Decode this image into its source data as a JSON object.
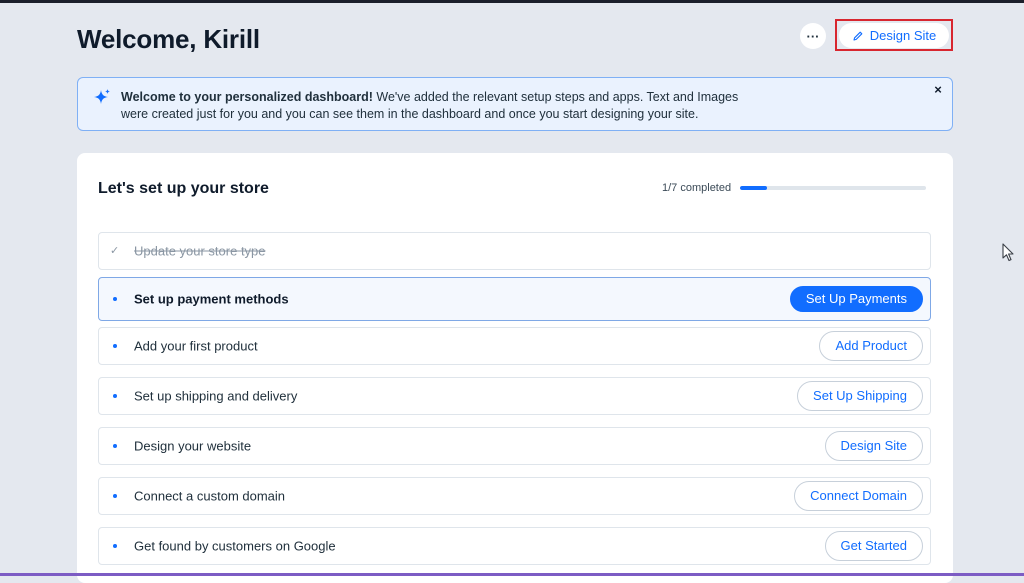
{
  "header": {
    "title": "Welcome, Kirill",
    "more_label": "···",
    "design_site_label": "Design Site"
  },
  "banner": {
    "bold_text": "Welcome to your personalized dashboard!",
    "text": " We've added the relevant setup steps and apps. Text and Images were created just for you and you can see them in the dashboard and once you start designing your site.",
    "close_label": "×"
  },
  "setup": {
    "title": "Let's set up your store",
    "progress_label": "1/7 completed",
    "progress_fraction": 0.143,
    "tasks": [
      {
        "label": "Update your store type",
        "status": "done",
        "check": "✓"
      },
      {
        "label": "Set up payment methods",
        "status": "active",
        "button": "Set Up Payments"
      },
      {
        "label": "Add your first product",
        "status": "todo",
        "button": "Add Product"
      },
      {
        "label": "Set up shipping and delivery",
        "status": "todo",
        "button": "Set Up Shipping"
      },
      {
        "label": "Design your website",
        "status": "todo",
        "button": "Design Site"
      },
      {
        "label": "Connect a custom domain",
        "status": "todo",
        "button": "Connect Domain"
      },
      {
        "label": "Get found by customers on Google",
        "status": "todo",
        "button": "Get Started"
      }
    ]
  },
  "colors": {
    "accent": "#116dff",
    "page_background": "#e4e8ef",
    "highlight_border": "#d8262f"
  }
}
